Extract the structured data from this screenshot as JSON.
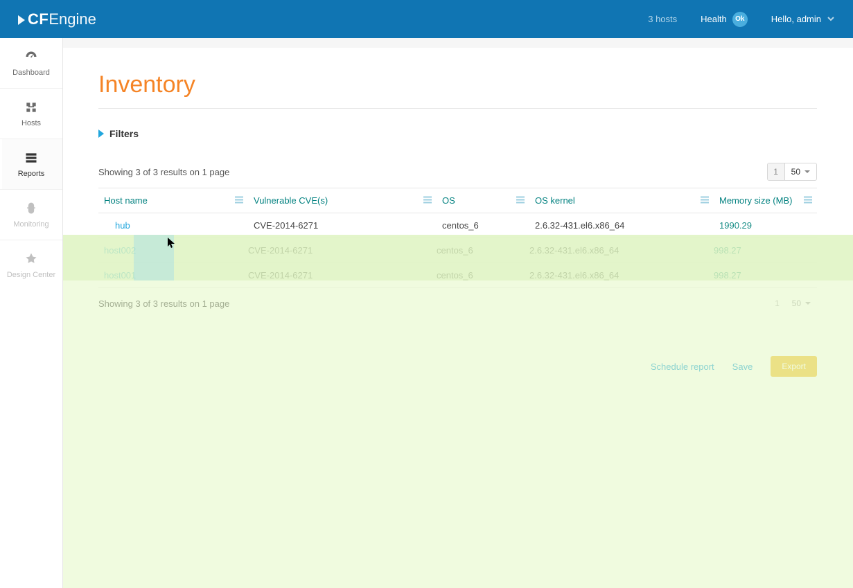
{
  "brand": {
    "cf": "CF",
    "engine": "Engine"
  },
  "topbar": {
    "hosts": "3 hosts",
    "health_label": "Health",
    "health_badge": "Ok",
    "greeting": "Hello, admin"
  },
  "sidebar": {
    "items": [
      {
        "label": "Dashboard"
      },
      {
        "label": "Hosts"
      },
      {
        "label": "Reports"
      },
      {
        "label": "Monitoring"
      },
      {
        "label": "Design Center"
      }
    ]
  },
  "page": {
    "title": "Inventory",
    "filters_label": "Filters",
    "results_text": "Showing 3 of 3 results on 1 page",
    "page_number": "1",
    "page_size": "50"
  },
  "table": {
    "columns": [
      "Host name",
      "Vulnerable CVE(s)",
      "OS",
      "OS kernel",
      "Memory size (MB)"
    ],
    "rows": [
      {
        "host": "hub",
        "cve": "CVE-2014-6271",
        "os": "centos_6",
        "kernel": "2.6.32-431.el6.x86_64",
        "mem": "1990.29"
      },
      {
        "host": "host002",
        "cve": "CVE-2014-6271",
        "os": "centos_6",
        "kernel": "2.6.32-431.el6.x86_64",
        "mem": "998.27"
      },
      {
        "host": "host001",
        "cve": "CVE-2014-6271",
        "os": "centos_6",
        "kernel": "2.6.32-431.el6.x86_64",
        "mem": "998.27"
      }
    ]
  },
  "actions": {
    "schedule": "Schedule report",
    "save": "Save",
    "export": "Export"
  }
}
